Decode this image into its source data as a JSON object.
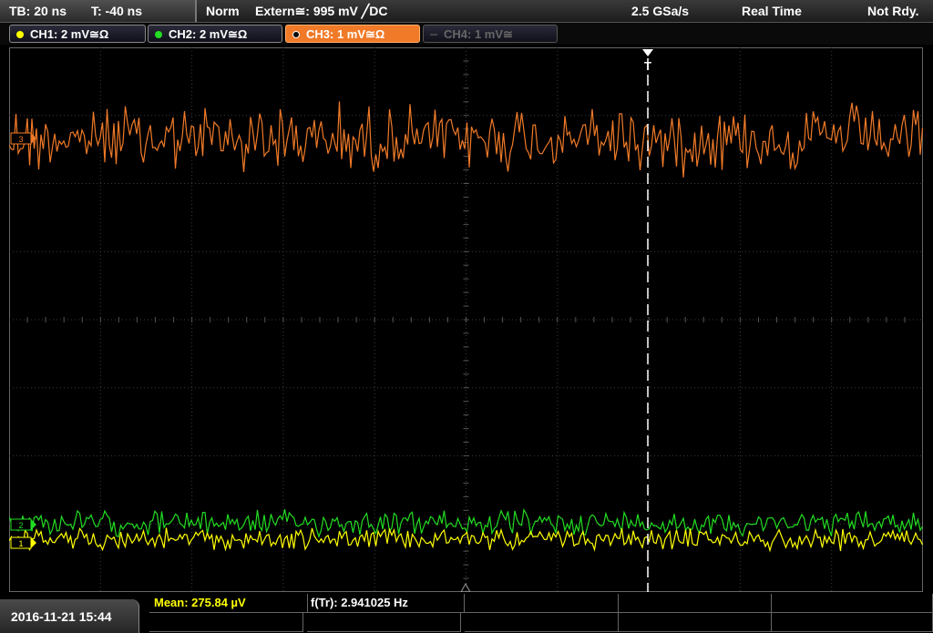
{
  "topbar": {
    "timebase": "TB: 20 ns",
    "trigger_time": "T: -40 ns",
    "mode": "Norm",
    "trigger_source": "Extern≅: 995 mV ╱DC",
    "sample_rate": "2.5 GSa/s",
    "acq_mode": "Real Time",
    "status": "Not Rdy."
  },
  "channels": [
    {
      "label": "CH1: 2 mV≅Ω",
      "color": "#ffff00"
    },
    {
      "label": "CH2: 2 mV≅Ω",
      "color": "#22dd22"
    },
    {
      "label": "CH3: 1 mV≅Ω",
      "color": "#f07a28"
    },
    {
      "label": "CH4: 1 mV≅",
      "color": "#555555"
    }
  ],
  "trigger_marker": "T",
  "footer": {
    "datetime": "2016-11-21 15:44",
    "mean": "Mean: 275.84 µV",
    "freq": "f(Tr): 2.941025 Hz"
  },
  "colors": {
    "ch1": "#ffff00",
    "ch2": "#22dd22",
    "ch3": "#f07a28",
    "grid": "#3c3c3c",
    "trigger_line": "#ffffff"
  }
}
